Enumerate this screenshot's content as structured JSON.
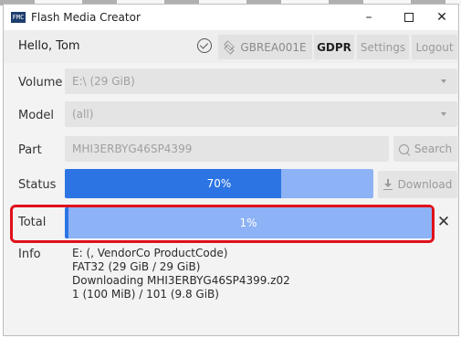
{
  "window": {
    "title": "Flash Media Creator",
    "app_icon_text": "FMC",
    "controls": {
      "minimize": "–",
      "close": "✕"
    }
  },
  "header": {
    "greeting": "Hello, Tom",
    "device_label": "GBREA001E",
    "gdpr_label": "GDPR",
    "settings_label": "Settings",
    "logout_label": "Logout"
  },
  "form": {
    "volume": {
      "label": "Volume",
      "value": "E:\\ (29 GiB)"
    },
    "model": {
      "label": "Model",
      "value": "(all)"
    },
    "part": {
      "label": "Part",
      "placeholder": "MHI3ERBYG46SP4399",
      "search_label": "Search"
    },
    "status": {
      "label": "Status",
      "progress_text": "70%",
      "progress": 0.7,
      "download_label": "Download"
    },
    "total": {
      "label": "Total",
      "progress_text": "1%",
      "progress": 0.01
    },
    "info": {
      "label": "Info",
      "lines": [
        "E: (, VendorCo ProductCode)",
        "FAT32 (29 GiB / 29 GiB)",
        "Downloading MHI3ERBYG46SP4399.z02",
        "1 (100 MiB) / 101 (9.8 GiB)"
      ]
    }
  },
  "colors": {
    "progress_fill": "#2c74e4",
    "progress_track": "#8db2f5",
    "highlight": "#e0101a"
  }
}
